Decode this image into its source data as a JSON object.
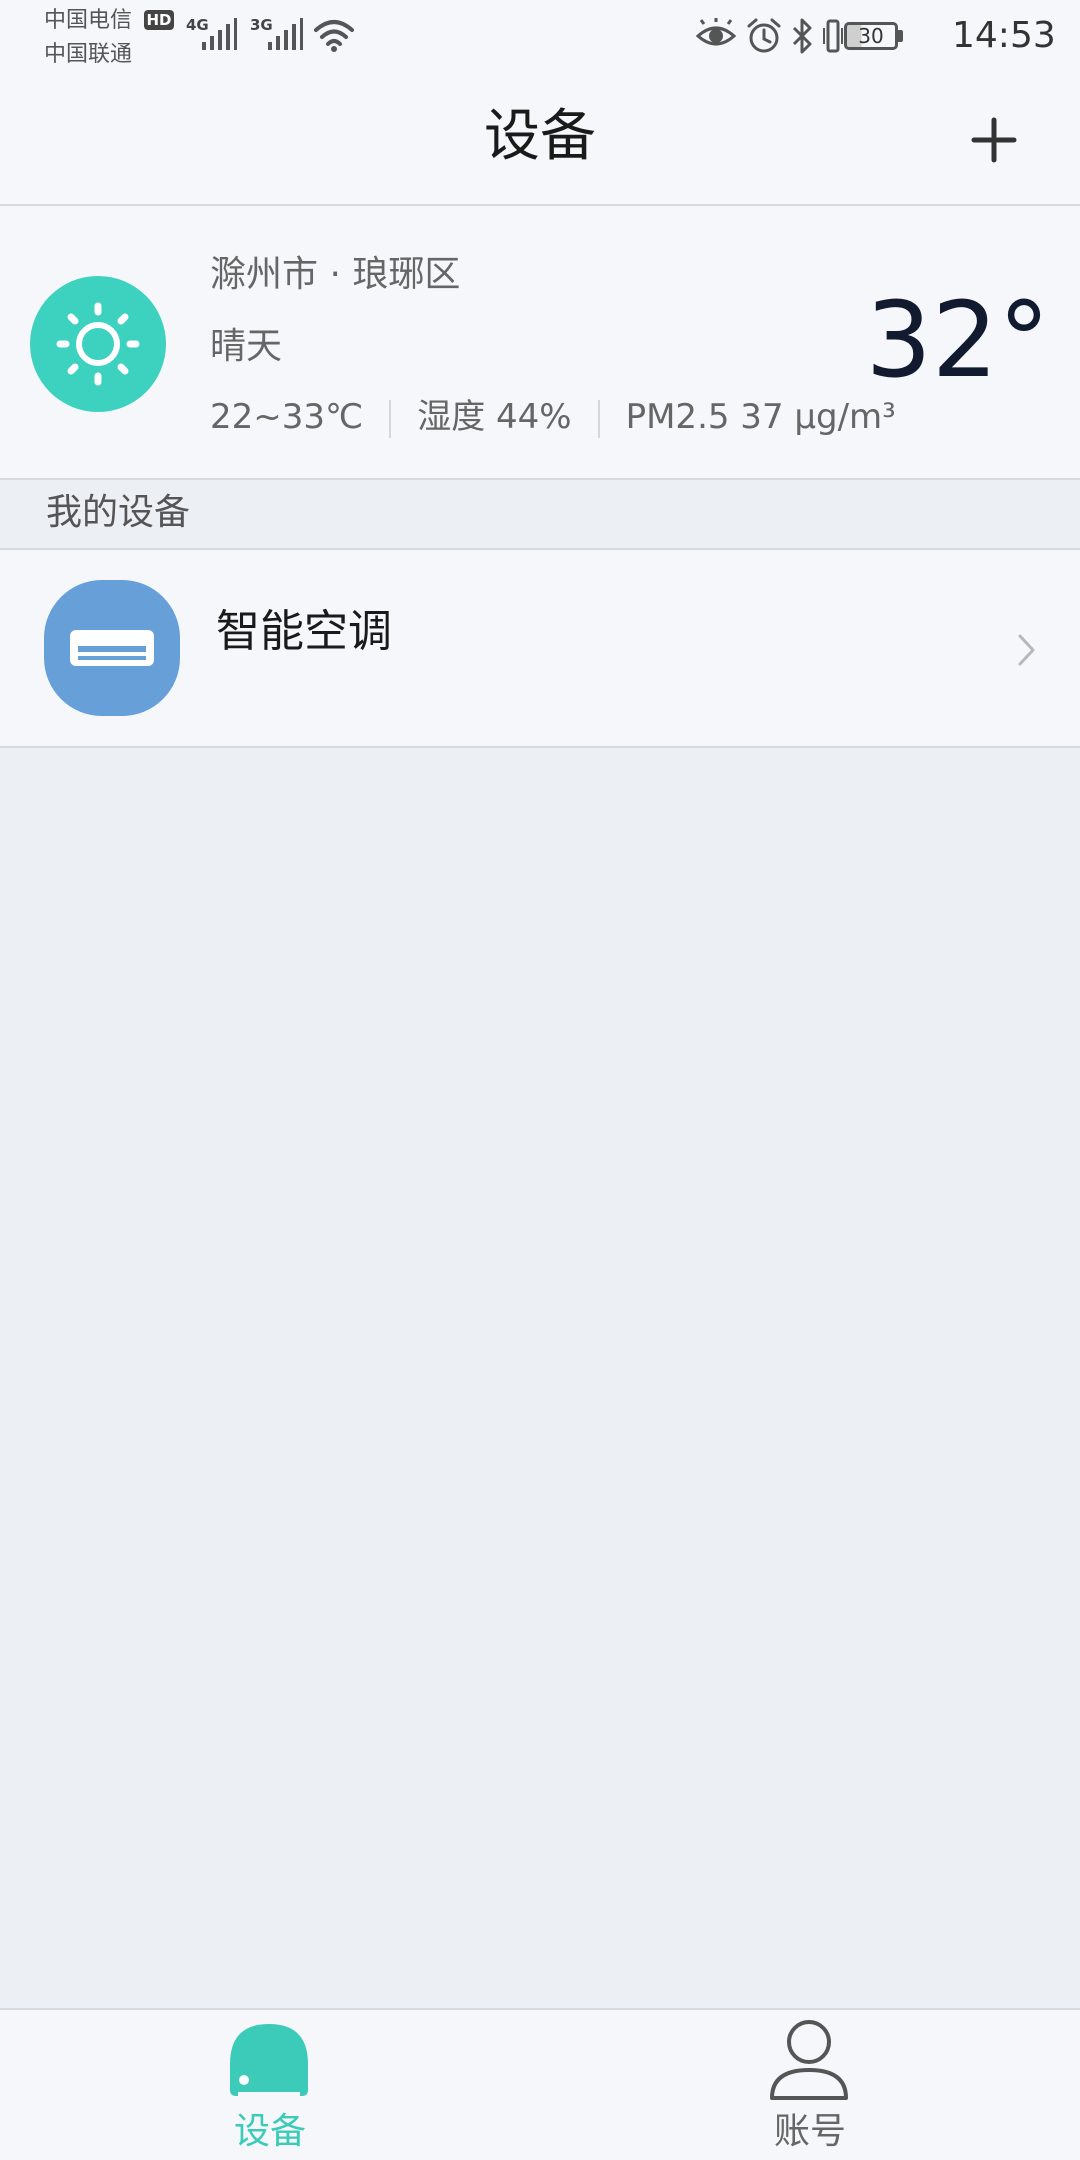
{
  "status_bar": {
    "carrier_1": "中国电信",
    "carrier_2": "中国联通",
    "hd_badge": "HD",
    "net_1": "4G",
    "net_2": "3G",
    "battery": "30",
    "time": "14:53",
    "icons": [
      "signal-icon",
      "wifi-icon",
      "eye-icon",
      "alarm-icon",
      "bluetooth-icon",
      "vibrate-icon",
      "battery-icon"
    ]
  },
  "header": {
    "title": "设备",
    "add_icon": "plus-icon"
  },
  "weather": {
    "icon": "sun-icon",
    "location": "滁州市 · 琅琊区",
    "condition": "晴天",
    "temp_range": "22~33℃",
    "humidity": "湿度 44%",
    "pm25": "PM2.5 37 μg/m³",
    "temperature": "32°",
    "accent_color": "#3dd1c0"
  },
  "devices": {
    "section_title": "我的设备",
    "items": [
      {
        "name": "智能空调",
        "icon": "air-conditioner-icon",
        "icon_color": "#679fd9"
      }
    ]
  },
  "bottom_nav": {
    "active_color": "#3dcbb9",
    "items": [
      {
        "label": "设备",
        "icon": "device-icon",
        "active": true
      },
      {
        "label": "账号",
        "icon": "account-icon",
        "active": false
      }
    ]
  }
}
